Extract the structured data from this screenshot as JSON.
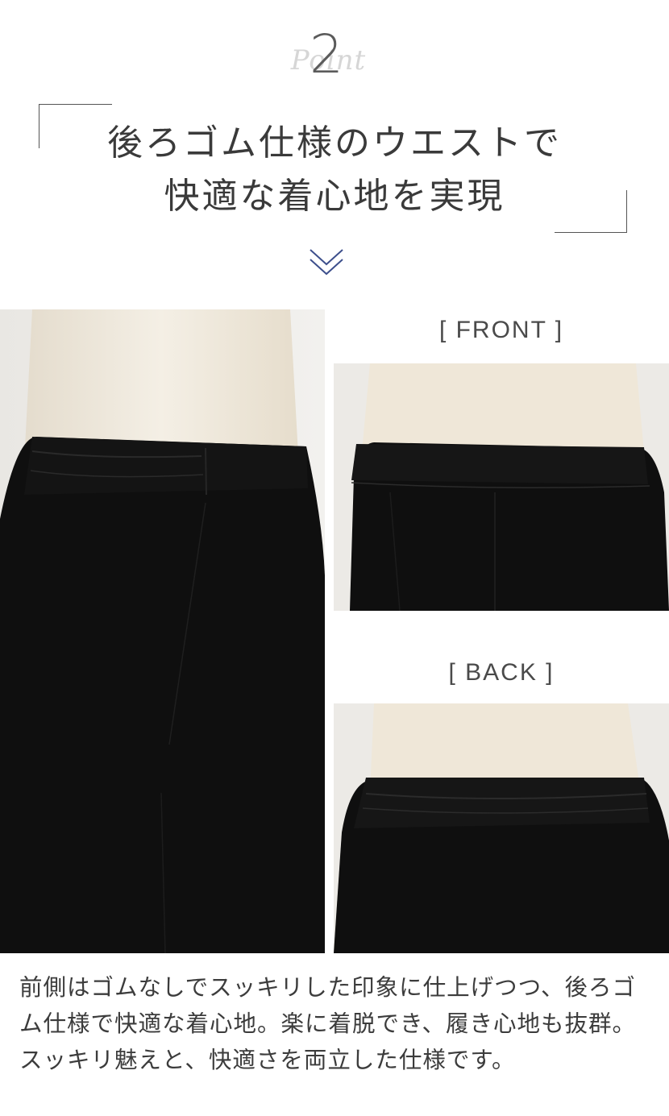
{
  "point": {
    "number": "2",
    "script": "Point"
  },
  "headline": {
    "line1": "後ろゴム仕様のウエストで",
    "line2": "快適な着心地を実現"
  },
  "labels": {
    "front": "[ FRONT ]",
    "back": "[ BACK ]"
  },
  "description": {
    "line1": "前側はゴムなしでスッキリした印象に仕上げつつ、後ろゴ",
    "line2": "ム仕様で快適な着心地。楽に着脱でき、履き心地も抜群。",
    "line3": "スッキリ魅えと、快適さを両立した仕様です。"
  },
  "colors": {
    "accent": "#3d4f8c",
    "text": "#3a3a3a",
    "fabric": "#0e0e0e"
  },
  "icons": {
    "chevron": "double-chevron-down-icon"
  }
}
